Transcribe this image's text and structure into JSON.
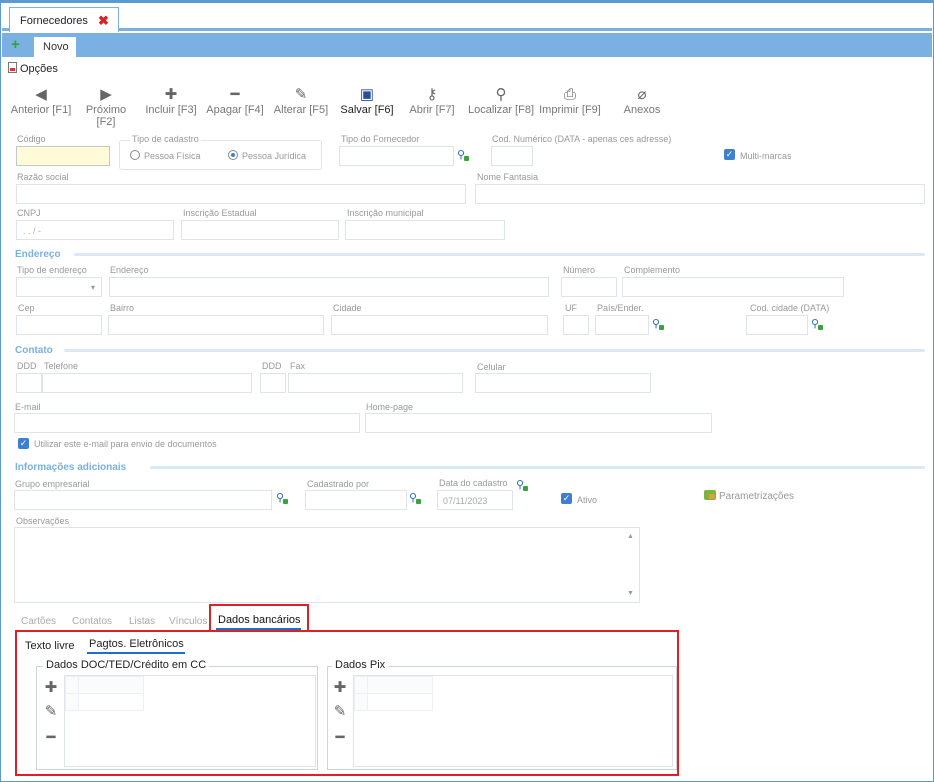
{
  "window": {
    "tab_title": "Fornecedores",
    "close_symbol": "✖"
  },
  "subtab": {
    "label": "Novo"
  },
  "options": {
    "label": "Opções"
  },
  "toolbar": {
    "buttons": [
      {
        "label": "Anterior [F1]",
        "icon": "arrow-left-circle-icon"
      },
      {
        "label": "Próximo [F2]",
        "icon": "arrow-right-circle-icon"
      },
      {
        "label": "Incluir [F3]",
        "icon": "plus-icon"
      },
      {
        "label": "Apagar [F4]",
        "icon": "minus-icon"
      },
      {
        "label": "Alterar [F5]",
        "icon": "edit-pencil-icon"
      },
      {
        "label": "Salvar [F6]",
        "icon": "floppy-disk-icon"
      },
      {
        "label": "Abrir [F7]",
        "icon": "key-icon"
      },
      {
        "label": "Localizar [F8]",
        "icon": "search-icon"
      },
      {
        "label": "Imprimir [F9]",
        "icon": "printer-icon"
      },
      {
        "label": "Anexos",
        "icon": "paperclip-icon"
      }
    ]
  },
  "form": {
    "codigo_label": "Código",
    "tipo_cadastro_label": "Tipo de cadastro",
    "pessoa_fisica": "Pessoa Física",
    "pessoa_juridica": "Pessoa Jurídica",
    "tipo_fornecedor_label": "Tipo do Fornecedor",
    "cod_numerico_label": "Cod. Numérico (DATA - apenas ces adresse)",
    "multi_marcas_label": "Multi-marcas",
    "razao_social_label": "Razão social",
    "nome_fantasia_label": "Nome Fantasia",
    "cnpj_label": "CNPJ",
    "cnpj_mask": ". .  /  -",
    "inscricao_estadual_label": "Inscrição Estadual",
    "inscricao_municipal_label": "Inscrição municipal",
    "endereco_section": "Endereço",
    "tipo_endereco_label": "Tipo de endereço",
    "endereco_label": "Endereço",
    "numero_label": "Número",
    "complemento_label": "Complemento",
    "cep_label": "Cep",
    "bairro_label": "Bairro",
    "cidade_label": "Cidade",
    "uf_label": "UF",
    "pais_label": "País/Ender.",
    "cod_cidade_label": "Cod. cidade (DATA)",
    "contato_section": "Contato",
    "ddd1_label": "DDD",
    "telefone_label": "Telefone",
    "ddd2_label": "DDD",
    "fax_label": "Fax",
    "celular_label": "Celular",
    "email_label": "E-mail",
    "homepage_label": "Home-page",
    "usar_email_label": "Utilizar este e-mail para envio de documentos",
    "info_section": "Informações adicionais",
    "grupo_label": "Grupo empresarial",
    "cadastrado_label": "Cadastrado por",
    "data_cadastro_label": "Data do cadastro",
    "data_cadastro_value": "07/11/2023",
    "ativo_label": "Ativo",
    "parametrizacoes_label": "Parametrizações",
    "observacoes_label": "Observações"
  },
  "bottom_tabs": [
    "Cartões",
    "Contatos",
    "Listas",
    "Vínculos",
    "Dados bancários"
  ],
  "banking": {
    "inner_tabs": [
      "Texto livre",
      "Pagtos. Eletrônicos"
    ],
    "doc_group_title": "Dados DOC/TED/Crédito em CC",
    "pix_group_title": "Dados Pix"
  },
  "colors": {
    "accent": "#7ab0e2",
    "highlight": "#e01f26",
    "active_underline": "#1f6fc7"
  }
}
